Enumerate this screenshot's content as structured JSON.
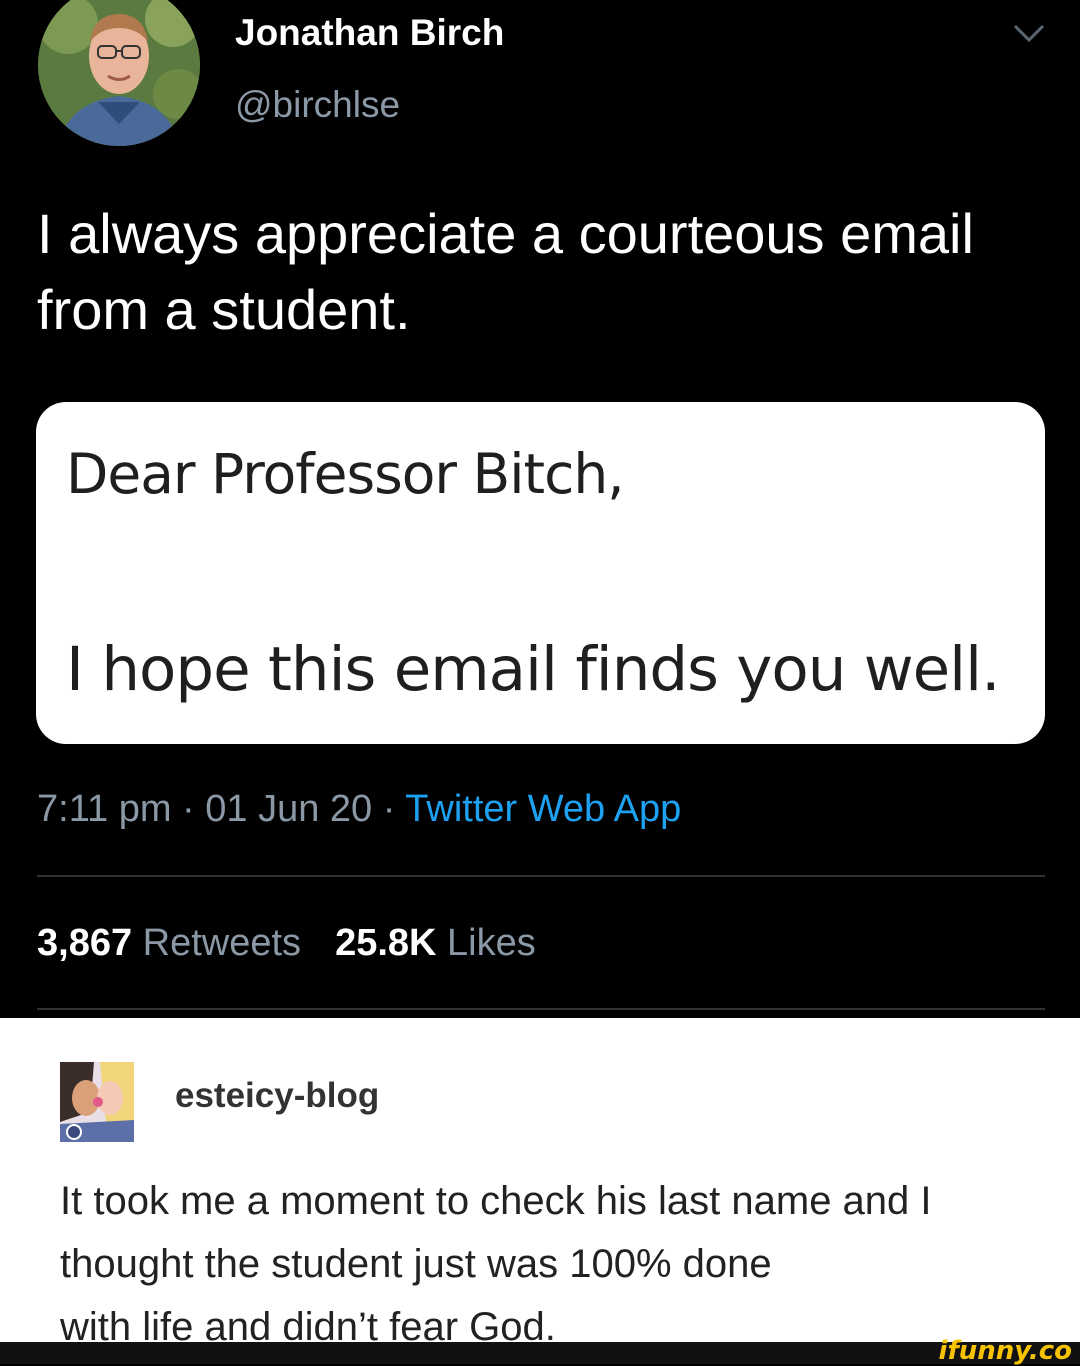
{
  "tweet": {
    "display_name": "Jonathan Birch",
    "handle": "@birchlse",
    "text": "I always appreciate a courteous email from a student.",
    "email": {
      "greeting": "Dear Professor Bitch,",
      "line": "I hope this email finds you well."
    },
    "time": "7:11 pm",
    "separator": " · ",
    "date": "01 Jun 20",
    "app": "Twitter Web App",
    "retweets_count": "3,867",
    "retweets_label": "Retweets",
    "likes_count": "25.8K",
    "likes_label": "Likes"
  },
  "post": {
    "blog_name": "esteicy-blog",
    "text": "It took me a moment to check his last name and I thought the student just was 100% done",
    "text_last_line": "with life and didn’t fear God."
  },
  "watermark": "ifunny.co",
  "colors": {
    "tweet_bg": "#000000",
    "muted": "#8b98a5",
    "link": "#1da1f2",
    "post_bg": "#ffffff",
    "watermark": "#f7c300"
  }
}
